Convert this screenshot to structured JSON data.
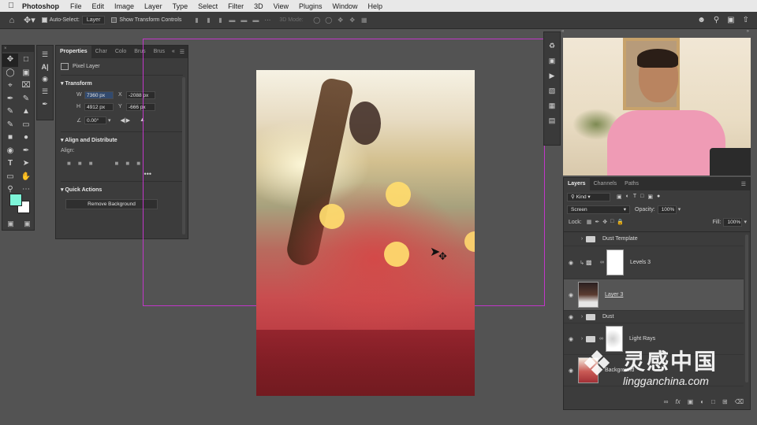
{
  "menubar": {
    "app": "Photoshop",
    "menus": [
      "File",
      "Edit",
      "Image",
      "Layer",
      "Type",
      "Select",
      "Filter",
      "3D",
      "View",
      "Plugins",
      "Window",
      "Help"
    ]
  },
  "options": {
    "auto_select_label": "Auto-Select:",
    "auto_select_value": "Layer",
    "show_transform_label": "Show Transform Controls",
    "mode_3d_label": "3D Mode:"
  },
  "properties": {
    "tabs": [
      "Properties",
      "Char",
      "Colo",
      "Brus",
      "Brus"
    ],
    "layer_type": "Pixel Layer",
    "transform_heading": "Transform",
    "w_label": "W",
    "w_value": "7360 px",
    "x_label": "X",
    "x_value": "-2088 px",
    "h_label": "H",
    "h_value": "4912 px",
    "y_label": "Y",
    "y_value": "-666 px",
    "angle_value": "0.00°",
    "align_heading": "Align and Distribute",
    "align_label": "Align:",
    "more_dots": "•••",
    "quick_actions_heading": "Quick Actions",
    "remove_bg_button": "Remove Background"
  },
  "layers": {
    "tabs": [
      "Layers",
      "Channels",
      "Paths"
    ],
    "kind_label": "Kind",
    "blend_mode": "Screen",
    "opacity_label": "Opacity:",
    "opacity_value": "100%",
    "lock_label": "Lock:",
    "fill_label": "Fill:",
    "fill_value": "100%",
    "items": [
      {
        "name": "Dust Template"
      },
      {
        "name": "Levels 3"
      },
      {
        "name": "Layer 3"
      },
      {
        "name": "Dust"
      },
      {
        "name": "Light Rays"
      },
      {
        "name": "Background"
      }
    ]
  },
  "watermark": {
    "cn": "灵感中国",
    "en": "lingganchina.com"
  },
  "colors": {
    "foreground": "#7df5d8",
    "background": "#ffffff",
    "guide": "#c236c9"
  }
}
